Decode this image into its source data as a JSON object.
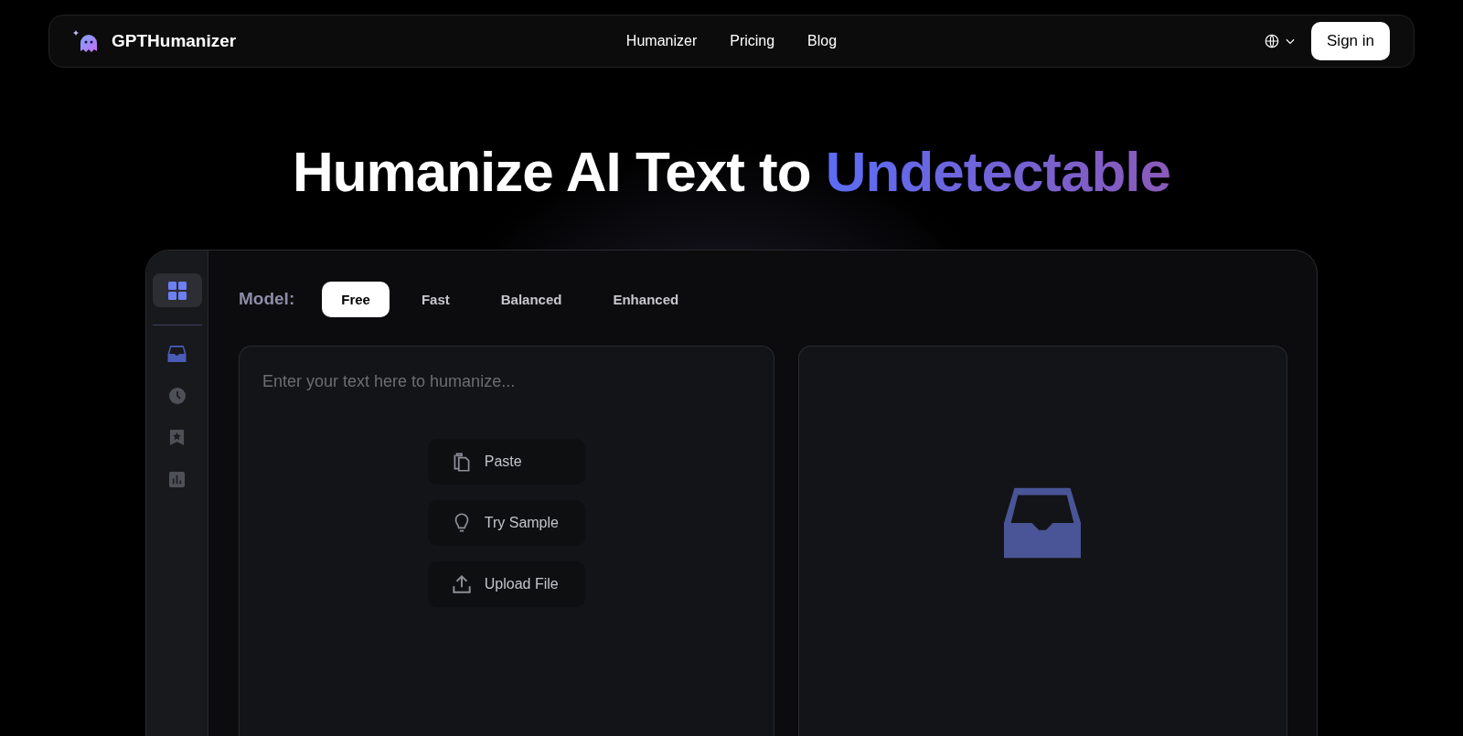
{
  "nav": {
    "brand": "GPTHumanizer",
    "links": [
      "Humanizer",
      "Pricing",
      "Blog"
    ],
    "sign_in": "Sign in"
  },
  "hero": {
    "title": "Humanize AI Text to",
    "highlight": "Undetectable"
  },
  "sidebar": {
    "items": [
      {
        "kind": "grid",
        "selected": true
      },
      {
        "kind": "inbox",
        "selected": false
      },
      {
        "kind": "clock",
        "selected": false
      },
      {
        "kind": "bookmark",
        "selected": false
      },
      {
        "kind": "chart",
        "selected": false
      }
    ]
  },
  "model": {
    "label": "Model:",
    "tabs": [
      {
        "label": "Free",
        "selected": true
      },
      {
        "label": "Fast",
        "selected": false
      },
      {
        "label": "Balanced",
        "selected": false
      },
      {
        "label": "Enhanced",
        "selected": false
      }
    ]
  },
  "input": {
    "placeholder": "Enter your text here to humanize...",
    "actions": [
      {
        "kind": "paste",
        "label": "Paste"
      },
      {
        "kind": "sample",
        "label": "Try Sample"
      },
      {
        "kind": "upload",
        "label": "Upload File"
      }
    ]
  }
}
